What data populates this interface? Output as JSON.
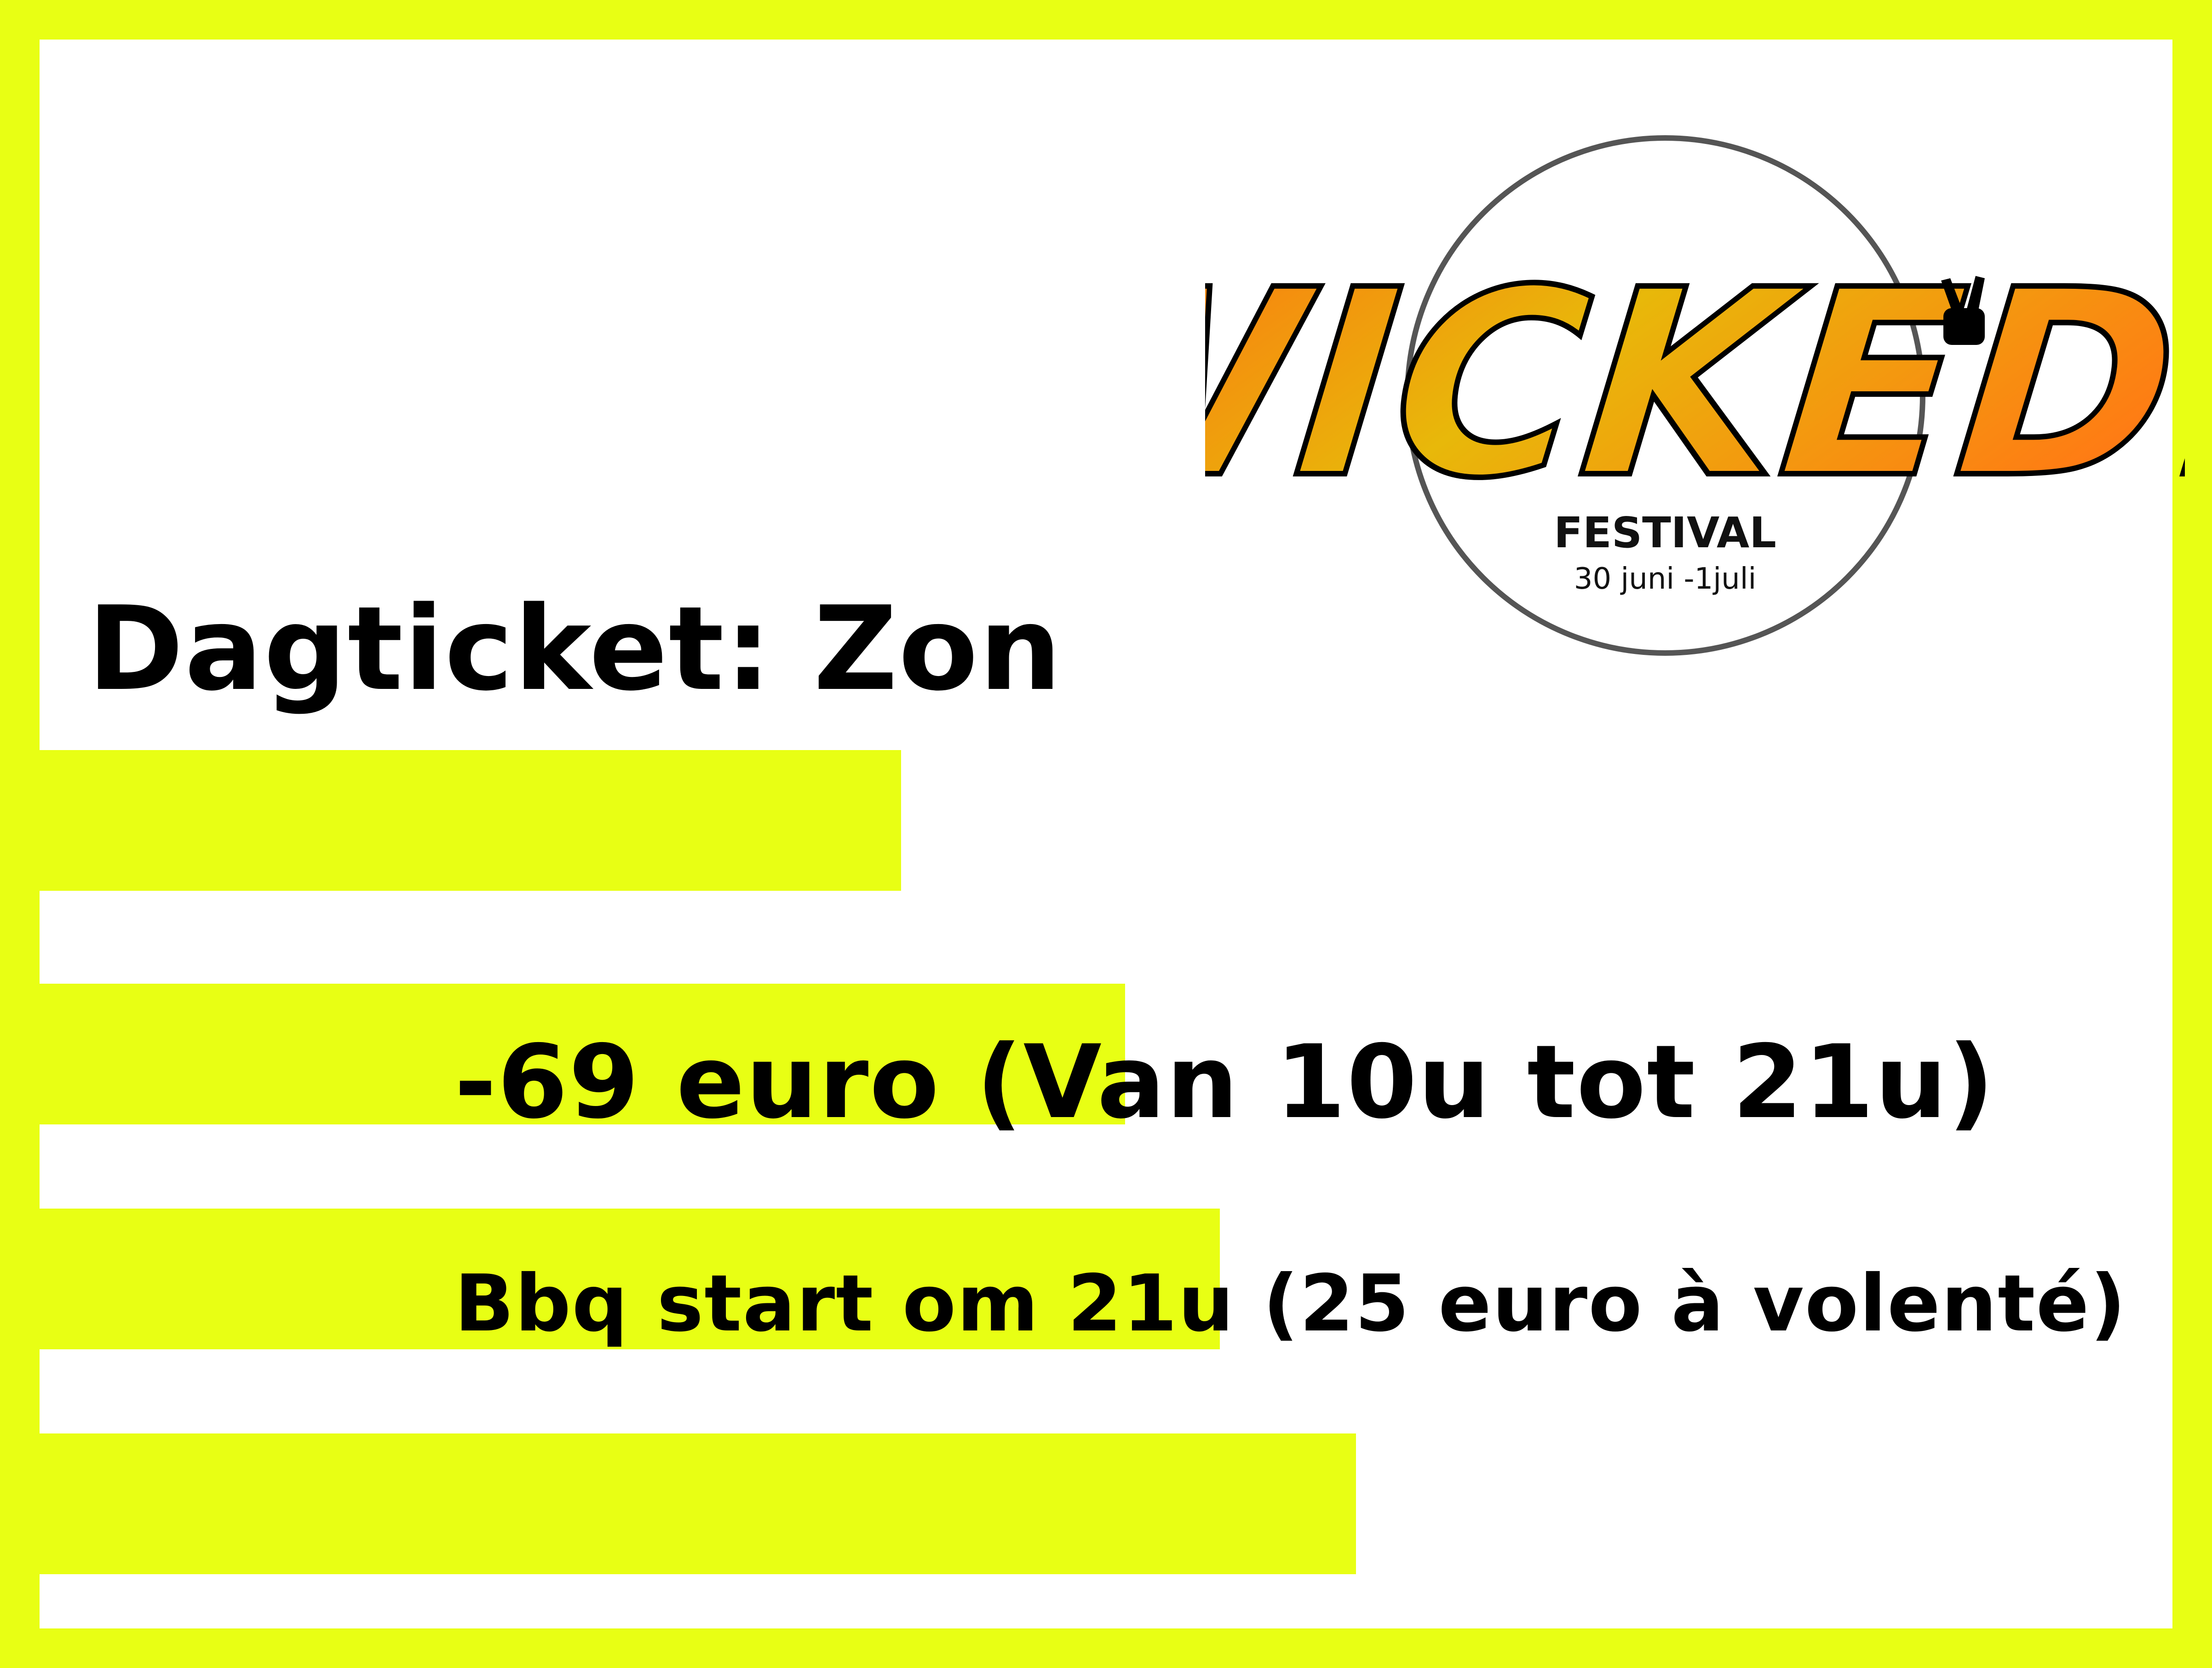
{
  "colors": {
    "background_accent": "#E8FF14",
    "panel": "#FFFFFF",
    "text": "#000000",
    "logo_gradient_start": "#FF6A12",
    "logo_gradient_end": "#E8C40A",
    "logo_circle": "#555555"
  },
  "logo": {
    "wordmark": "WICKED!",
    "subtitle": "FESTIVAL",
    "dates": "30 juni -1juli",
    "icon": "peace-hand-icon"
  },
  "ticket": {
    "title": "Dagticket: Zon",
    "price_line": "-69 euro (Van 10u tot 21u)",
    "bbq_line": "Bbq start om 21u (25 euro à volenté)"
  }
}
